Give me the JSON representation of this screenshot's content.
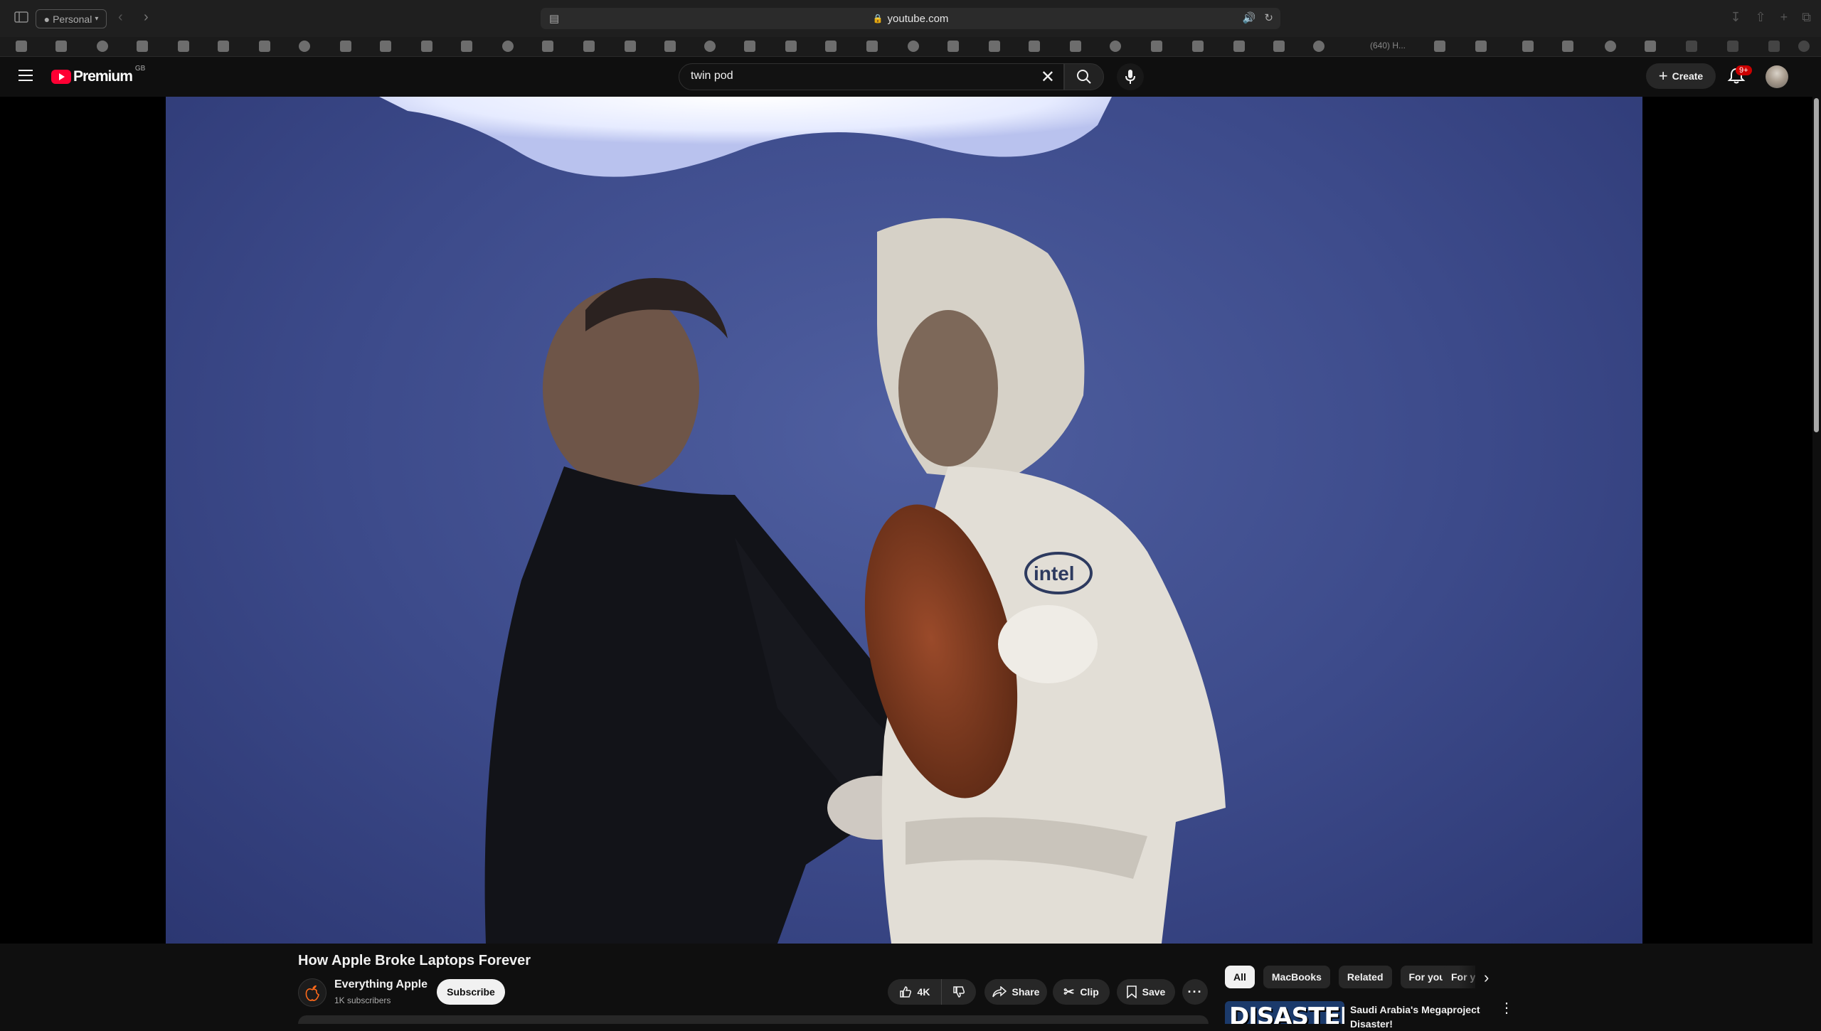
{
  "browser": {
    "profile": "Personal",
    "url": "youtube.com",
    "tab_label": "(640) H..."
  },
  "header": {
    "logo_text": "Premium",
    "country_code": "GB",
    "search_value": "twin pod",
    "create_label": "Create",
    "notification_count": "9+"
  },
  "video": {
    "title": "How Apple Broke Laptops Forever",
    "channel_name": "Everything Apple",
    "subscribers": "1K subscribers",
    "subscribe_label": "Subscribe",
    "like_count": "4K",
    "share_label": "Share",
    "clip_label": "Clip",
    "save_label": "Save",
    "frame_label": "intel"
  },
  "sidebar": {
    "chips": [
      {
        "label": "All",
        "active": true
      },
      {
        "label": "MacBooks"
      },
      {
        "label": "Related"
      },
      {
        "label": "For you"
      },
      {
        "label": "For y"
      }
    ],
    "recommendation": {
      "thumb_text": "DISASTER",
      "title": "Saudi Arabia's Megaproject Disaster!"
    }
  },
  "colors": {
    "brand_red": "#ff0033",
    "background": "#0f0f0f",
    "stage_blue": "#3c4a8a",
    "notification_red": "#cc0000"
  }
}
